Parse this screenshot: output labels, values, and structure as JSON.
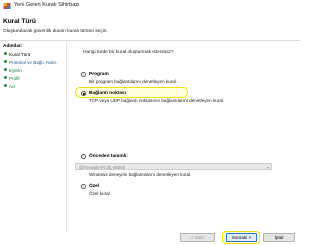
{
  "window": {
    "title": "Yeni Gelen Kuralı Sihirbazı",
    "icon": "firewall-shield-icon"
  },
  "header": {
    "title": "Kural Türü",
    "subtitle": "Oluşturulacak güvenlik duvarı kuralı türünü seçin."
  },
  "sidebar": {
    "heading": "Adımlar:",
    "steps": [
      {
        "label": "Kural Türü"
      },
      {
        "label": "Protokol ve Bağlı. Nokt."
      },
      {
        "label": "Eylem"
      },
      {
        "label": "Profil"
      },
      {
        "label": "Ad"
      }
    ]
  },
  "main": {
    "question": "Hangi türde bir kural oluşturmak istersiniz?",
    "options": [
      {
        "title": "Program",
        "desc": "Bir program bağlantılarını denetleyen kural.",
        "selected": false
      },
      {
        "title": "Bağlantı noktası",
        "desc": "TCP veya UDP bağlantı noktasının bağlantılarını denetleyen kural.",
        "selected": true
      },
      {
        "title": "Önceden tanımlı:",
        "desc": "Windows deneyimi bağlantılarını denetleyen kural.",
        "selected": false
      },
      {
        "title": "Özel",
        "desc": "Özel kural",
        "selected": false
      }
    ],
    "predefined_value": "@FirewallAPI.dll,-80200"
  },
  "buttons": {
    "back": "< Geri",
    "next": "Sonraki >",
    "cancel": "İptal"
  },
  "colors": {
    "highlight": "#f1e400",
    "step_dot": "#2f8a3a",
    "accent": "#2a74c9"
  }
}
